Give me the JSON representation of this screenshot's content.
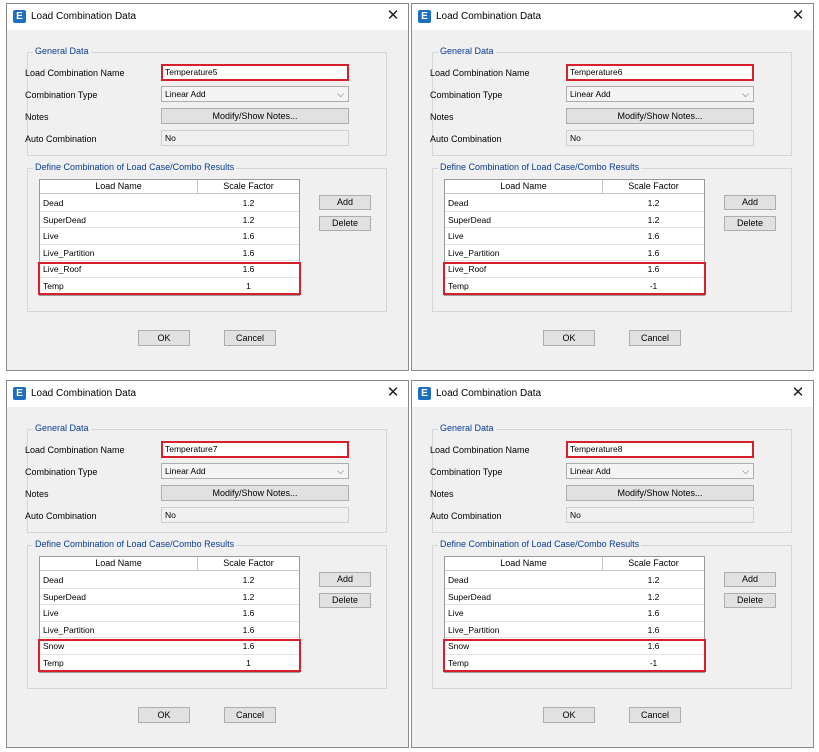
{
  "dialogs": [
    {
      "title": "Load Combination Data",
      "general": {
        "group_title": "General Data",
        "name_label": "Load Combination Name",
        "name_value": "Temperature5",
        "type_label": "Combination Type",
        "type_value": "Linear Add",
        "notes_label": "Notes",
        "notes_button": "Modify/Show Notes...",
        "auto_label": "Auto Combination",
        "auto_value": "No"
      },
      "define": {
        "group_title": "Define Combination of Load Case/Combo Results",
        "headers": [
          "Load Name",
          "Scale Factor"
        ],
        "rows": [
          {
            "name": "Dead",
            "scale": "1.2"
          },
          {
            "name": "SuperDead",
            "scale": "1.2"
          },
          {
            "name": "Live",
            "scale": "1.6"
          },
          {
            "name": "Live_Partition",
            "scale": "1.6"
          },
          {
            "name": "Live_Roof",
            "scale": "1.6"
          },
          {
            "name": "Temp",
            "scale": "1"
          }
        ],
        "add_button": "Add",
        "delete_button": "Delete"
      },
      "ok_button": "OK",
      "cancel_button": "Cancel"
    },
    {
      "title": "Load Combination Data",
      "general": {
        "group_title": "General Data",
        "name_label": "Load Combination Name",
        "name_value": "Temperature6",
        "type_label": "Combination Type",
        "type_value": "Linear Add",
        "notes_label": "Notes",
        "notes_button": "Modify/Show Notes...",
        "auto_label": "Auto Combination",
        "auto_value": "No"
      },
      "define": {
        "group_title": "Define Combination of Load Case/Combo Results",
        "headers": [
          "Load Name",
          "Scale Factor"
        ],
        "rows": [
          {
            "name": "Dead",
            "scale": "1.2"
          },
          {
            "name": "SuperDead",
            "scale": "1.2"
          },
          {
            "name": "Live",
            "scale": "1.6"
          },
          {
            "name": "Live_Partition",
            "scale": "1.6"
          },
          {
            "name": "Live_Roof",
            "scale": "1.6"
          },
          {
            "name": "Temp",
            "scale": "-1"
          }
        ],
        "add_button": "Add",
        "delete_button": "Delete"
      },
      "ok_button": "OK",
      "cancel_button": "Cancel"
    },
    {
      "title": "Load Combination Data",
      "general": {
        "group_title": "General Data",
        "name_label": "Load Combination Name",
        "name_value": "Temperature7",
        "type_label": "Combination Type",
        "type_value": "Linear Add",
        "notes_label": "Notes",
        "notes_button": "Modify/Show Notes...",
        "auto_label": "Auto Combination",
        "auto_value": "No"
      },
      "define": {
        "group_title": "Define Combination of Load Case/Combo Results",
        "headers": [
          "Load Name",
          "Scale Factor"
        ],
        "rows": [
          {
            "name": "Dead",
            "scale": "1.2"
          },
          {
            "name": "SuperDead",
            "scale": "1.2"
          },
          {
            "name": "Live",
            "scale": "1.6"
          },
          {
            "name": "Live_Partition",
            "scale": "1.6"
          },
          {
            "name": "Snow",
            "scale": "1.6"
          },
          {
            "name": "Temp",
            "scale": "1"
          }
        ],
        "add_button": "Add",
        "delete_button": "Delete"
      },
      "ok_button": "OK",
      "cancel_button": "Cancel"
    },
    {
      "title": "Load Combination Data",
      "general": {
        "group_title": "General Data",
        "name_label": "Load Combination Name",
        "name_value": "Temperature8",
        "type_label": "Combination Type",
        "type_value": "Linear Add",
        "notes_label": "Notes",
        "notes_button": "Modify/Show Notes...",
        "auto_label": "Auto Combination",
        "auto_value": "No"
      },
      "define": {
        "group_title": "Define Combination of Load Case/Combo Results",
        "headers": [
          "Load Name",
          "Scale Factor"
        ],
        "rows": [
          {
            "name": "Dead",
            "scale": "1.2"
          },
          {
            "name": "SuperDead",
            "scale": "1.2"
          },
          {
            "name": "Live",
            "scale": "1.6"
          },
          {
            "name": "Live_Partition",
            "scale": "1.6"
          },
          {
            "name": "Snow",
            "scale": "1.6"
          },
          {
            "name": "Temp",
            "scale": "-1"
          }
        ],
        "add_button": "Add",
        "delete_button": "Delete"
      },
      "ok_button": "OK",
      "cancel_button": "Cancel"
    }
  ],
  "icons": {
    "app": "etabs-app-icon",
    "app_glyph": "E",
    "close": "close-icon",
    "close_glyph": "✕",
    "dropdown": "chevron-down-icon",
    "dropdown_glyph": "⌵"
  },
  "colors": {
    "highlight": "#d8202b",
    "group_title": "#0a3b91",
    "app_icon": "#1e6fc2"
  }
}
